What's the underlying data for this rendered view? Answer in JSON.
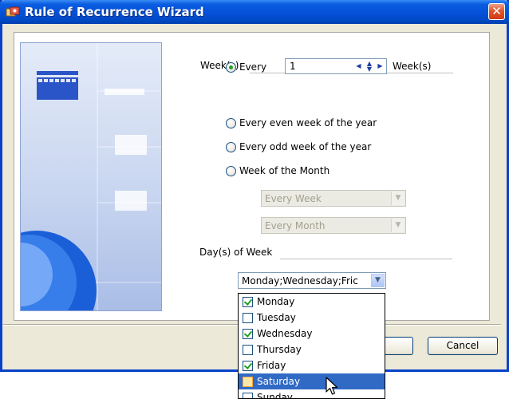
{
  "window": {
    "title": "Rule of Recurrence Wizard",
    "close_glyph": "✕"
  },
  "weeks_section": {
    "label": "Week(s)",
    "every_label": "Every",
    "every_value": "1",
    "every_suffix": "Week(s)",
    "options": [
      {
        "label": "Every",
        "checked": true
      },
      {
        "label": "Every even week of the year",
        "checked": false
      },
      {
        "label": "Every odd week of the year",
        "checked": false
      },
      {
        "label": "Week of the Month",
        "checked": false
      }
    ],
    "week_of_month_combo": "Every Week",
    "month_combo": "Every Month"
  },
  "days_section": {
    "label": "Day(s) of Week",
    "combo_value": "Monday;Wednesday;Fric",
    "days": [
      {
        "label": "Monday",
        "checked": true
      },
      {
        "label": "Tuesday",
        "checked": false
      },
      {
        "label": "Wednesday",
        "checked": true
      },
      {
        "label": "Thursday",
        "checked": false
      },
      {
        "label": "Friday",
        "checked": true
      },
      {
        "label": "Saturday",
        "checked": false,
        "highlighted": true
      },
      {
        "label": "Sunday",
        "checked": false
      }
    ]
  },
  "buttons": {
    "cancel": "Cancel"
  },
  "colors": {
    "titlebar": "#0550d8",
    "selection": "#316ac5",
    "checkmark": "#21a121"
  },
  "icons": {
    "title": "wizard-app-icon",
    "close": "close-icon",
    "dropdown": "chevron-down-icon",
    "cursor": "mouse-pointer-icon"
  }
}
